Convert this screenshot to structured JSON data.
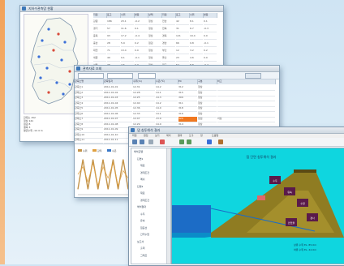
{
  "windows": {
    "map_window": {
      "title": "지하수관측망 현황",
      "stats_lines": [
        "관측소 152",
        "정상 141",
        "점검 8",
        "결측 3",
        "평균수위 -12.4 m"
      ],
      "table_headers": [
        "지점",
        "표고",
        "수위",
        "변동",
        "상태",
        "지점",
        "표고",
        "수위",
        "변동"
      ],
      "rows": [
        [
          "강원",
          "186",
          "23.1",
          "-0.2",
          "정상",
          "전남",
          "42",
          "8.1",
          "0.1"
        ],
        [
          "경기",
          "57",
          "11.6",
          "0.1",
          "정상",
          "전북",
          "31",
          "6.7",
          "-0.3"
        ],
        [
          "충북",
          "93",
          "17.2",
          "-0.4",
          "정상",
          "경북",
          "121",
          "19.4",
          "0.0"
        ],
        [
          "충남",
          "28",
          "5.9",
          "0.2",
          "점검",
          "경남",
          "66",
          "9.8",
          "-0.1"
        ],
        [
          "대전",
          "71",
          "13.4",
          "0.0",
          "정상",
          "부산",
          "12",
          "3.2",
          "0.2"
        ],
        [
          "세종",
          "49",
          "9.1",
          "-0.1",
          "정상",
          "울산",
          "23",
          "4.6",
          "0.0"
        ],
        [
          "서울",
          "38",
          "7.5",
          "0.3",
          "정상",
          "대구",
          "54",
          "8.8",
          "-0.2"
        ],
        [
          "인천",
          "15",
          "2.9",
          "0.1",
          "결측",
          "광주",
          "36",
          "6.2",
          "0.1"
        ]
      ]
    },
    "data_window": {
      "title": "관측자료 조회",
      "toolbar_fields": [
        "2011-01-01",
        "2011-12-31",
        "일자료",
        "조회"
      ],
      "headers": [
        "관측소명",
        "관측일자",
        "수위(m)",
        "수온(℃)",
        "EC",
        "구분",
        "비고"
      ],
      "rows": [
        [
          "관측소1",
          "2011-01-01",
          "12.31",
          "14.2",
          "312",
          "정상",
          ""
        ],
        [
          "관측소2",
          "2011-01-02",
          "12.28",
          "14.1",
          "315",
          "정상",
          ""
        ],
        [
          "관측소3",
          "2011-01-03",
          "12.25",
          "14.3",
          "309",
          "정상",
          ""
        ],
        [
          "관측소4",
          "2011-01-04",
          "12.40",
          "14.2",
          "311",
          "정상",
          ""
        ],
        [
          "관측소5",
          "2011-01-05",
          "12.36",
          "14.0",
          "318",
          "정상",
          ""
        ],
        [
          "관측소6",
          "2011-01-06",
          "12.33",
          "14.1",
          "316",
          "정상",
          ""
        ],
        [
          "관측소7",
          "2011-01-07",
          "12.47",
          "13.9",
          "320",
          "점검",
          "이상"
        ],
        [
          "관측소8",
          "2011-01-08",
          "12.29",
          "14.0",
          "314",
          "정상",
          ""
        ],
        [
          "관측소9",
          "2011-01-09",
          "12.22",
          "14.2",
          "310",
          "정상",
          ""
        ],
        [
          "관측소10",
          "2011-01-10",
          "12.26",
          "14.3",
          "308",
          "정상",
          ""
        ],
        [
          "관측소11",
          "2011-01-11",
          "12.31",
          "14.1",
          "313",
          "정상",
          ""
        ]
      ],
      "chart_legend": [
        "수위",
        "강우",
        "수온"
      ],
      "chart_data": {
        "type": "line",
        "series": [
          {
            "name": "수위",
            "values": [
              1,
              9,
              1,
              9,
              1,
              9,
              1,
              9,
              1,
              9,
              1
            ]
          },
          {
            "name": "강우",
            "values": [
              5,
              7,
              3,
              8,
              2,
              7,
              4,
              8,
              2,
              6,
              4
            ]
          }
        ]
      }
    },
    "analysis_window": {
      "title": "댐 침투해석 결과",
      "menu": [
        "파일",
        "편집",
        "보기",
        "해석",
        "결과",
        "도구",
        "창",
        "도움말"
      ],
      "tree": [
        "해석모델",
        " 단면1",
        "  재료",
        "  경계조건",
        "  메쉬",
        " 단면2",
        "  재료",
        "  경계조건",
        " 해석결과",
        "  수두",
        "  유속",
        "  침윤선",
        "  간극수압",
        " 보고서",
        "  출력",
        "  그래프"
      ],
      "view_title": "댐 단면 침투해석 결과",
      "view_labels": [
        "상류 수위 EL. 85.0m",
        "하류 수위 EL. 42.0m"
      ],
      "box_labels": [
        "수두",
        "유속",
        "수압",
        "경사",
        "안전율"
      ],
      "accent": "#0fd6df"
    }
  }
}
